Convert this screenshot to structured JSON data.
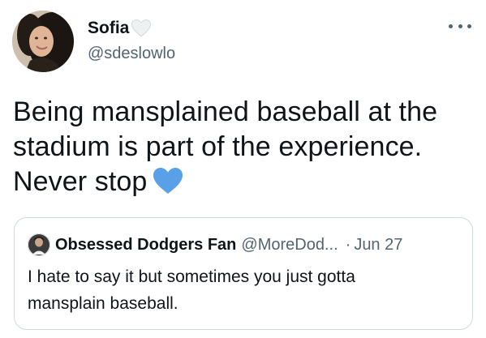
{
  "author": {
    "display_name": "Sofia",
    "handle": "@sdeslowlo",
    "name_emoji": "white-heart-icon",
    "avatar": "profile-photo"
  },
  "more_menu": "more-options-icon",
  "tweet": {
    "lines": [
      "Being mansplained baseball at the",
      "stadium is part of the experience.",
      "Never stop"
    ],
    "trailing_emoji": "blue-heart-icon"
  },
  "quoted_tweet": {
    "display_name": "Obsessed Dodgers Fan",
    "handle": "@MoreDod...",
    "separator": "·",
    "date": "Jun 27",
    "lines": [
      "I hate to say it but sometimes you just gotta",
      "mansplain baseball."
    ]
  },
  "colors": {
    "text": "#0f1419",
    "secondary": "#536471",
    "border": "#cfd9de",
    "blue_heart": "#5aa0e6",
    "white_heart": "#eef0f2"
  }
}
